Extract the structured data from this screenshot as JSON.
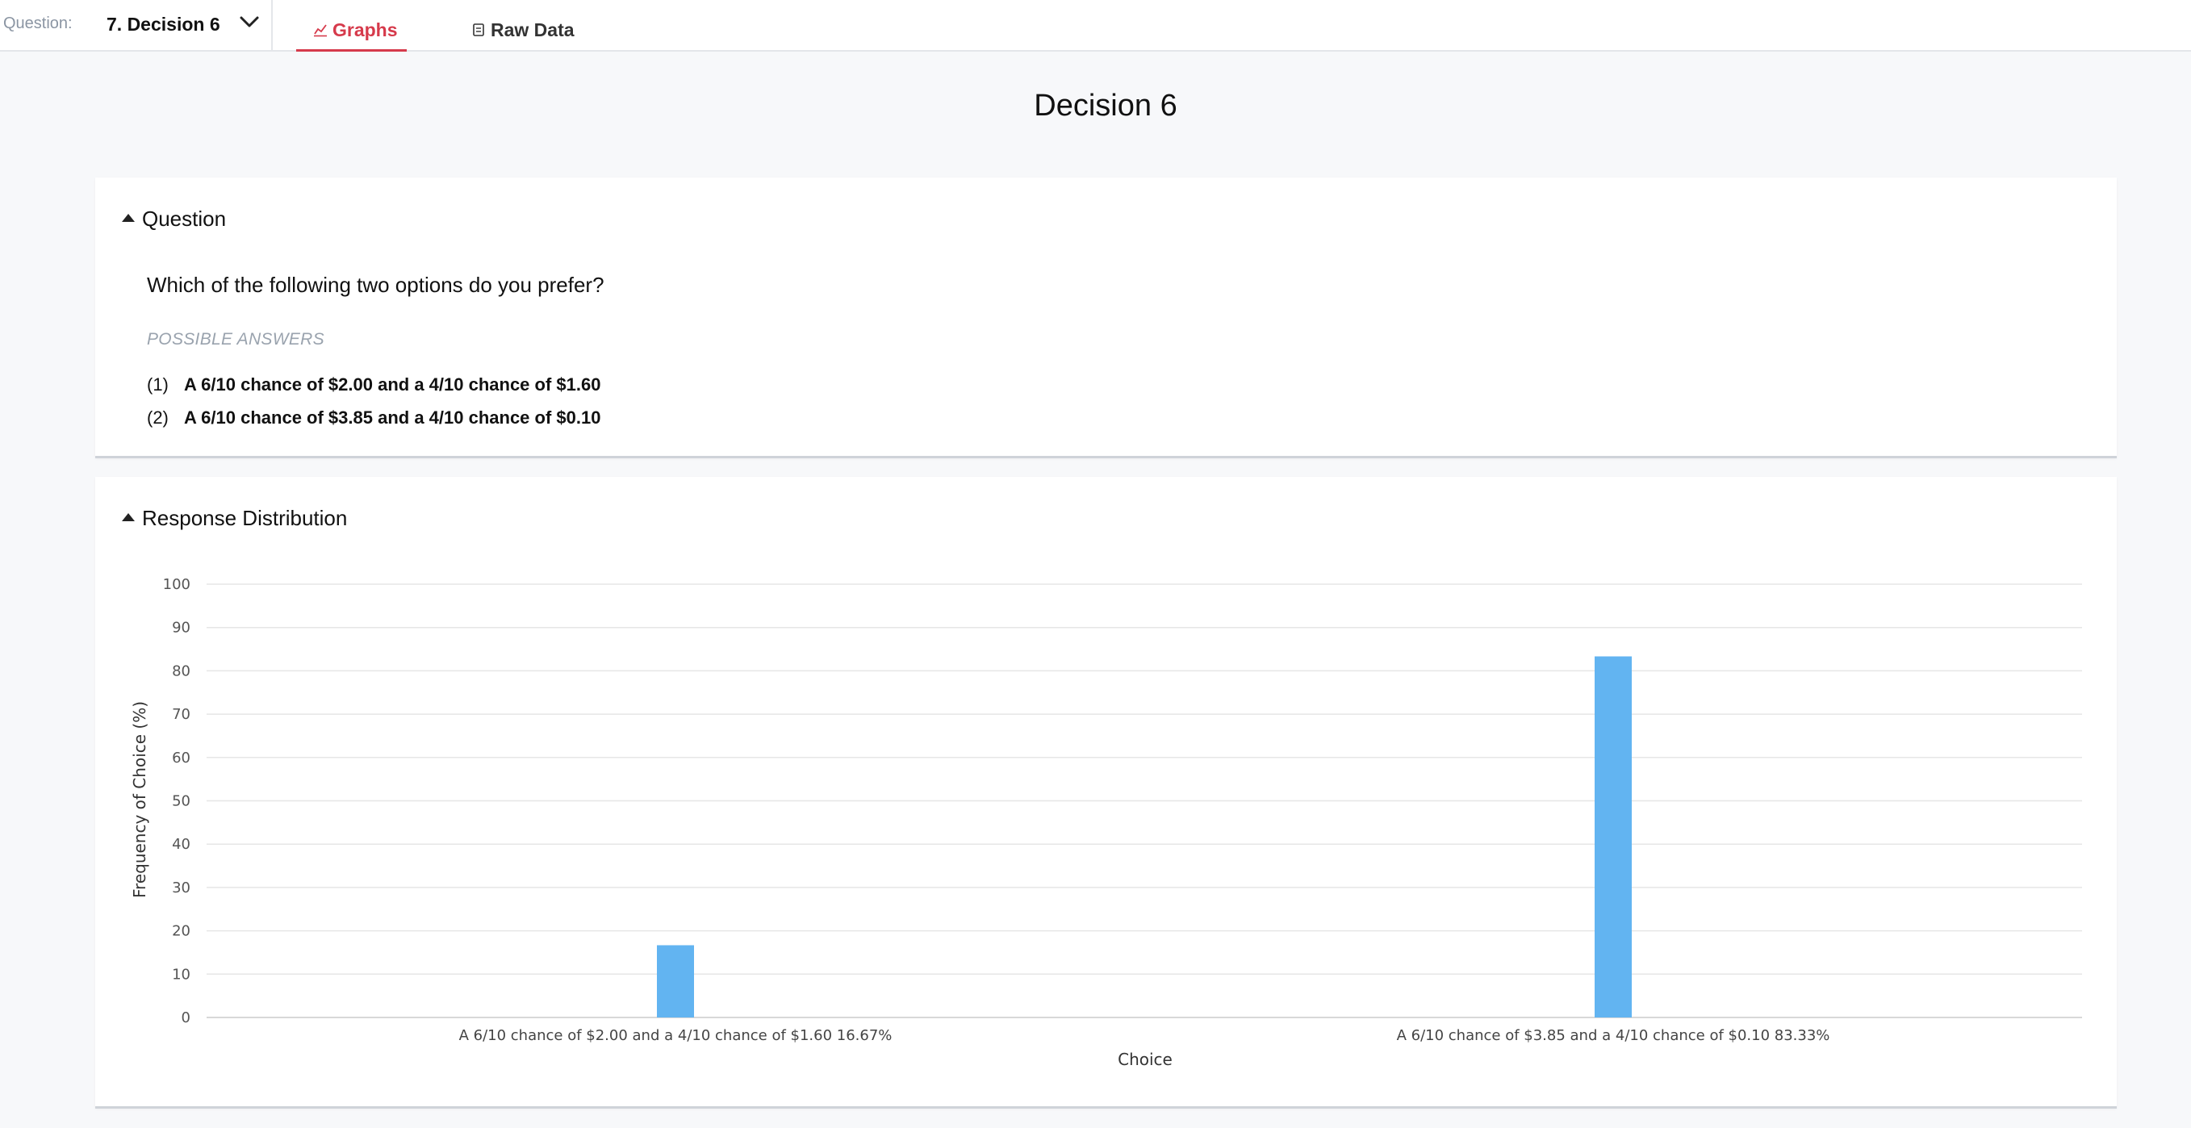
{
  "topbar": {
    "question_label": "Question:",
    "question_value": "7. Decision 6",
    "tabs": [
      {
        "label": "Graphs",
        "active": true,
        "icon": "chart-icon"
      },
      {
        "label": "Raw Data",
        "active": false,
        "icon": "document-icon"
      }
    ]
  },
  "page": {
    "title": "Decision 6"
  },
  "question_card": {
    "heading": "Question",
    "text": "Which of the following two options do you prefer?",
    "possible_answers_label": "POSSIBLE ANSWERS",
    "answers": [
      {
        "num": "(1)",
        "text": "A 6/10 chance of $2.00 and a 4/10 chance of $1.60"
      },
      {
        "num": "(2)",
        "text": "A 6/10 chance of $3.85 and a 4/10 chance of $0.10"
      }
    ]
  },
  "distribution_card": {
    "heading": "Response Distribution"
  },
  "colors": {
    "accent": "#d63a4b",
    "bar": "#62b4f1",
    "grid": "#e6e6e6"
  },
  "chart_data": {
    "type": "bar",
    "categories": [
      "A 6/10 chance of $2.00 and a 4/10 chance of $1.60 16.67%",
      "A 6/10 chance of $3.85 and a 4/10 chance of $0.10 83.33%"
    ],
    "values": [
      16.67,
      83.33
    ],
    "xlabel": "Choice",
    "ylabel": "Frequency of Choice (%)",
    "ylim": [
      0,
      100
    ],
    "yticks": [
      0,
      10,
      20,
      30,
      40,
      50,
      60,
      70,
      80,
      90,
      100
    ],
    "grid": true,
    "legend": "none"
  }
}
